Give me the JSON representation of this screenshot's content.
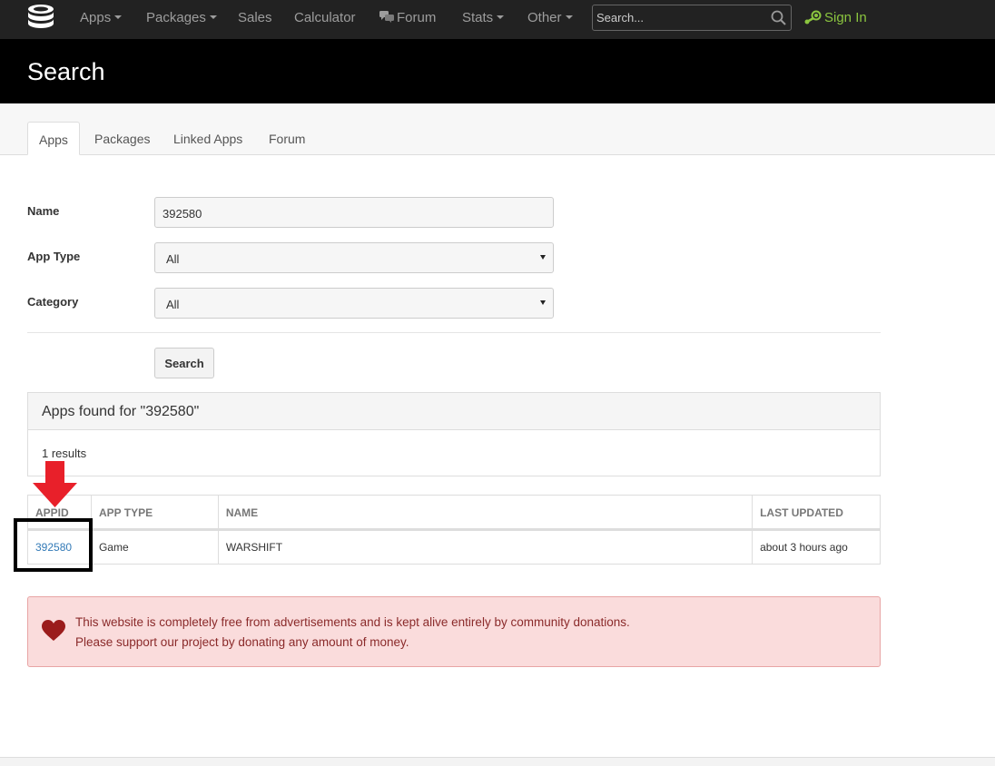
{
  "nav": {
    "items": [
      "Apps",
      "Packages",
      "Sales",
      "Calculator",
      "Forum",
      "Stats",
      "Other"
    ],
    "search_placeholder": "Search...",
    "signin_label": "Sign In"
  },
  "header": {
    "title": "Search"
  },
  "tabs": [
    "Apps",
    "Packages",
    "Linked Apps",
    "Forum"
  ],
  "form": {
    "name_label": "Name",
    "name_value": "392580",
    "app_type_label": "App Type",
    "app_type_value": "All",
    "category_label": "Category",
    "category_value": "All",
    "search_button": "Search"
  },
  "results": {
    "heading": "Apps found for \"392580\"",
    "count_text": "1 results"
  },
  "table": {
    "columns": [
      "APPID",
      "APP TYPE",
      "NAME",
      "LAST UPDATED"
    ],
    "rows": [
      {
        "appid": "392580",
        "app_type": "Game",
        "name": "WARSHIFT",
        "last_updated": "about 3 hours ago"
      }
    ]
  },
  "donation": {
    "line1": "This website is completely free from advertisements and is kept alive entirely by community donations.",
    "line2": "Please support our project by donating any amount of money."
  },
  "colors": {
    "navbar": "#222222",
    "header": "#000000",
    "signin": "#8bc53f",
    "link": "#337ab7",
    "alert_bg": "#fadcdc",
    "alert_text": "#8a2a2a",
    "annotation_arrow": "#e8202a"
  }
}
